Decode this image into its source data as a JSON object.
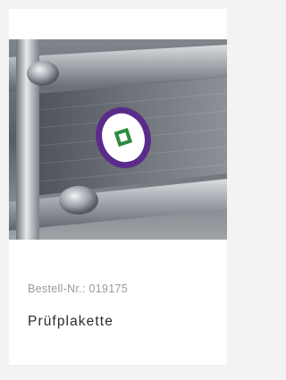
{
  "product": {
    "order_number": "Bestell-Nr.: 019175",
    "name": "Prüfplakette"
  },
  "image": {
    "subject": "inspection-sticker-on-metal-panel",
    "colors": {
      "sticker_ring": "#5a2c8a",
      "sticker_center": "#2e8a3e",
      "metal_dark": "#4f555b",
      "metal_light": "#c9cdd1"
    }
  }
}
